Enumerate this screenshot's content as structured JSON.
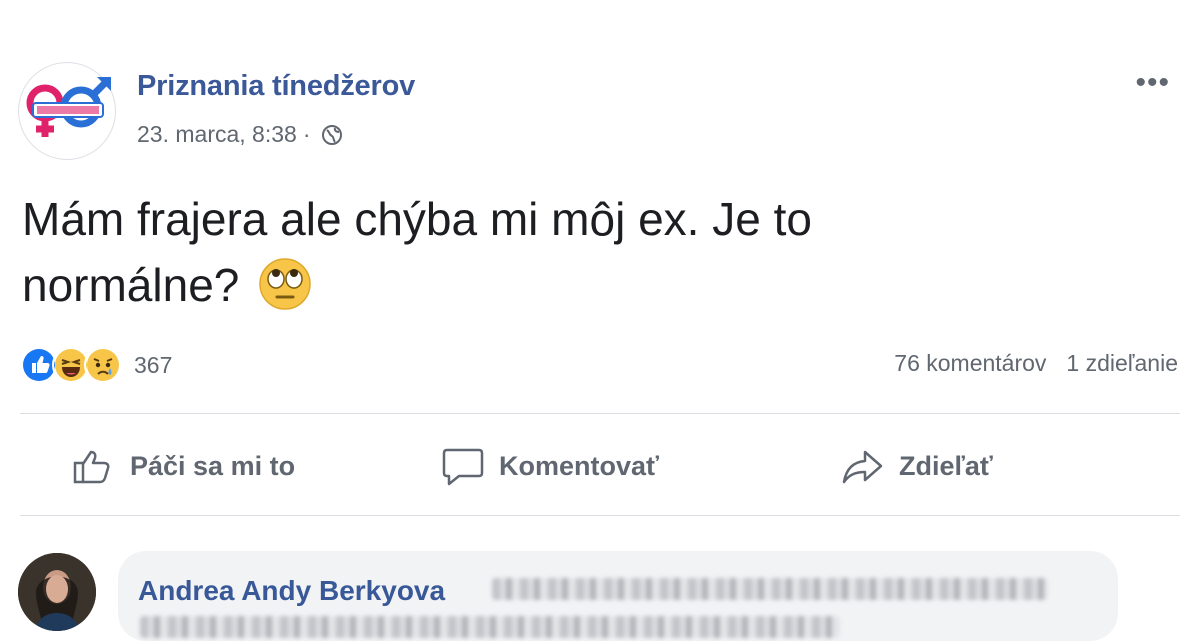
{
  "post": {
    "page_name": "Priznania tínedžerov",
    "timestamp": "23. marca, 8:38",
    "separator": "·",
    "audience_icon": "globe-icon",
    "menu_icon": "more-options-icon",
    "menu_glyph": "•••",
    "text_line1": "Mám frajera ale chýba mi môj ex. Je to",
    "text_line2": "normálne?",
    "emoji": "face-with-rolling-eyes"
  },
  "reactions": {
    "types": [
      "like-reaction-icon",
      "haha-reaction-icon",
      "sad-reaction-icon"
    ],
    "count": "367",
    "comments_count": "76 komentárov",
    "shares_count": "1 zdieľanie"
  },
  "actions": {
    "like_label": "Páči sa mi to",
    "comment_label": "Komentovať",
    "share_label": "Zdieľať"
  },
  "comment": {
    "author": "Andrea Andy Berkyova"
  },
  "colors": {
    "brand_link": "#3b5998",
    "secondary_text": "#606770",
    "like_blue": "#1877f2",
    "reaction_yellow": "#f7c548"
  }
}
